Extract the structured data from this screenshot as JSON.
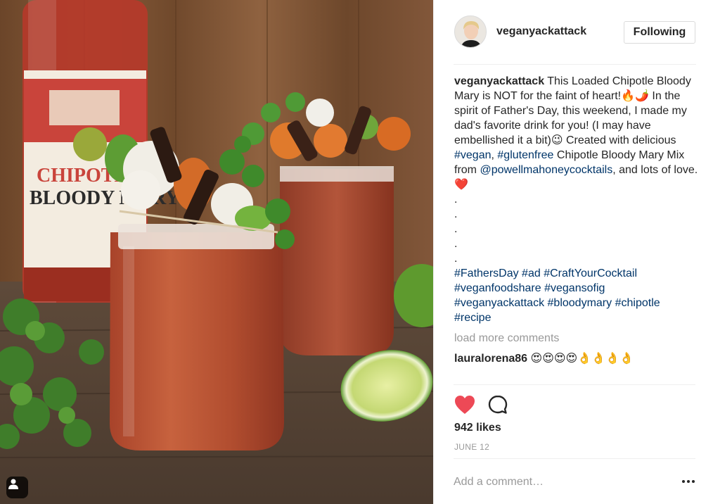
{
  "post": {
    "username": "veganyackattack",
    "follow_label": "Following",
    "caption": {
      "username": "veganyackattack",
      "text_1": " This Loaded Chipotle Bloody Mary is NOT for the faint of heart!🔥🌶️ In the spirit of Father's Day, this weekend, I made my dad's favorite drink for you! (I may have embellished it a bit)😉 Created with delicious ",
      "tag_vegan": "#vegan",
      "text_2": ", ",
      "tag_glutenfree": "#glutenfree",
      "text_3": " Chipotle Bloody Mary Mix from ",
      "mention": "@powellmahoneycocktails",
      "text_4": ", and lots of love.❤️",
      "dots": [
        ".",
        ".",
        ".",
        ".",
        "."
      ],
      "hashtags": [
        "#FathersDay",
        "#ad",
        "#CraftYourCocktail",
        "#veganfoodshare",
        "#vegansofig",
        "#veganyackattack",
        "#bloodymary",
        "#chipotle",
        "#recipe"
      ]
    },
    "load_more_label": "load more comments",
    "comment": {
      "username": "lauralorena86",
      "text": " 😍😍😍😍👌👌👌👌"
    },
    "likes_label": "942 likes",
    "date_label": "JUNE 12",
    "add_comment_placeholder": "Add a comment…",
    "image": {
      "bottle_label_line1": "CHIPOTLE",
      "bottle_label_line2": "BLOODY MARY"
    }
  },
  "colors": {
    "link": "#003569",
    "muted": "#999999",
    "text": "#262626",
    "like_heart": "#ed4956",
    "border": "#dbdbdb"
  },
  "icons": {
    "like": "heart-icon",
    "comment": "comment-bubble-icon",
    "more": "more-options-icon",
    "user_tag": "user-tag-icon"
  }
}
